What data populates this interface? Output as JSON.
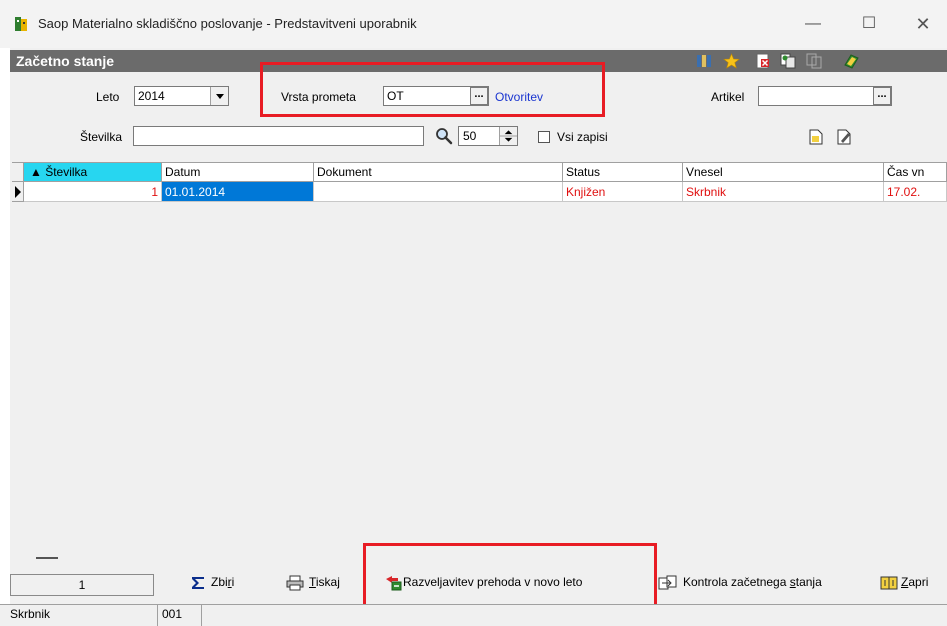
{
  "window": {
    "title": "Saop Materialno skladiščno poslovanje - Predstavitveni uporabnik",
    "minimize_glyph": "—",
    "maximize_glyph": "☐",
    "close_glyph": "✕"
  },
  "panel": {
    "title": "Začetno stanje"
  },
  "filters": {
    "leto_label": "Leto",
    "leto_value": "2014",
    "vrsta_label": "Vrsta prometa",
    "vrsta_value": "OT",
    "vrsta_desc": "Otvoritev",
    "artikel_label": "Artikel",
    "artikel_value": "",
    "stevilka_label": "Številka",
    "stevilka_value": "",
    "limit_value": "50",
    "vsi_label": "Vsi zapisi",
    "ellipsis": "..."
  },
  "table": {
    "columns": [
      "▲ Številka",
      "Datum",
      "Dokument",
      "Status",
      "Vnesel",
      "Čas vn"
    ],
    "rows": [
      {
        "stevilka": "1",
        "datum": "01.01.2014",
        "dokument": "",
        "status": "Knjižen",
        "vnesel": "Skrbnik",
        "cas": "17.02."
      }
    ]
  },
  "bottom": {
    "count": "1",
    "zbiri_pre": "Zbi",
    "zbiri_u": "r",
    "zbiri_post": "i",
    "tiskaj_u": "T",
    "tiskaj_post": "iskaj",
    "razveljavitev": "Razveljavitev prehoda v novo leto",
    "kontrola_pre": "Kontrola začetnega ",
    "kontrola_u": "s",
    "kontrola_post": "tanja",
    "zapri_u": "Z",
    "zapri_post": "apri"
  },
  "statusbar": {
    "user": "Skrbnik",
    "code": "001"
  },
  "colors": {
    "accent_red": "#e81c24",
    "selection_blue": "#0078d7",
    "sort_cyan": "#27d6f0",
    "link_blue": "#1a35d0"
  }
}
